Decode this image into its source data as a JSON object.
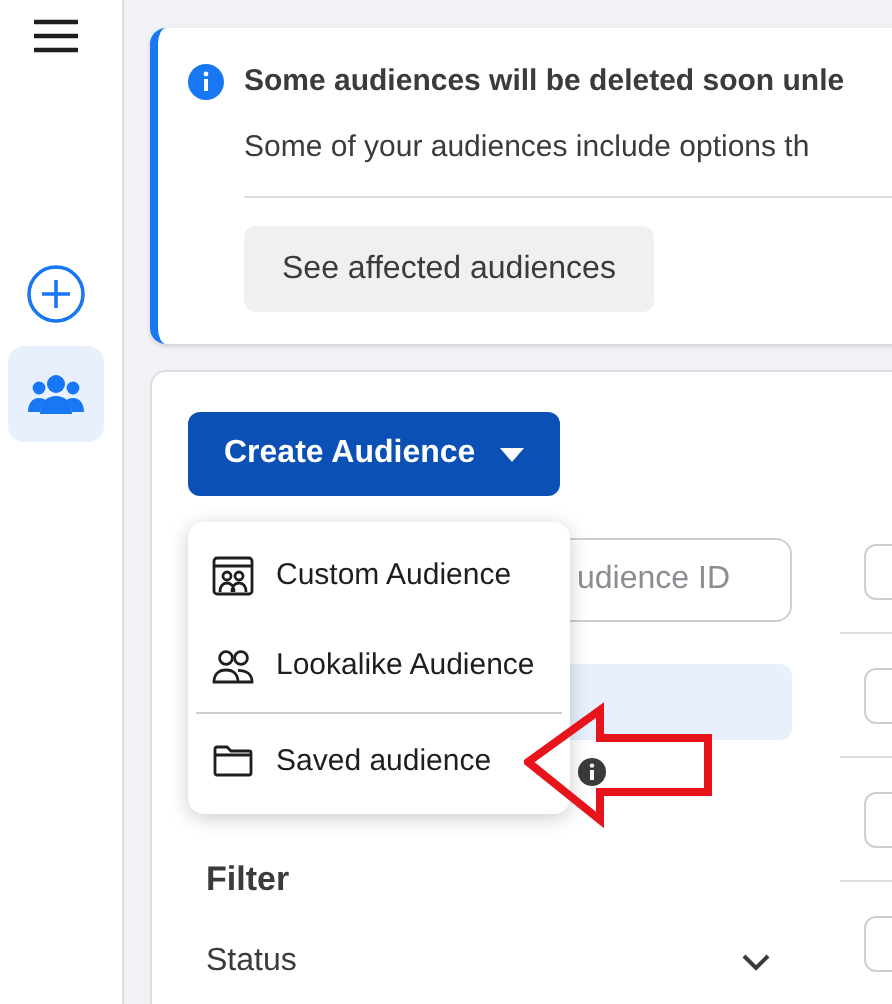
{
  "sidebar": {
    "items": [
      {
        "kind": "create",
        "selected": false
      },
      {
        "kind": "audiences",
        "selected": true
      }
    ]
  },
  "notice": {
    "title": "Some audiences will be deleted soon unle",
    "body": "Some of your audiences include options th",
    "button": "See affected audiences"
  },
  "create_button": {
    "label": "Create Audience"
  },
  "search": {
    "placeholder": "udience ID"
  },
  "menu": {
    "items": [
      {
        "kind": "custom",
        "label": "Custom Audience"
      },
      {
        "kind": "lookalike",
        "label": "Lookalike Audience"
      },
      {
        "kind": "saved",
        "label": "Saved audience"
      }
    ]
  },
  "filter": {
    "title": "Filter",
    "sections": [
      {
        "label": "Status",
        "expanded": false
      }
    ]
  }
}
